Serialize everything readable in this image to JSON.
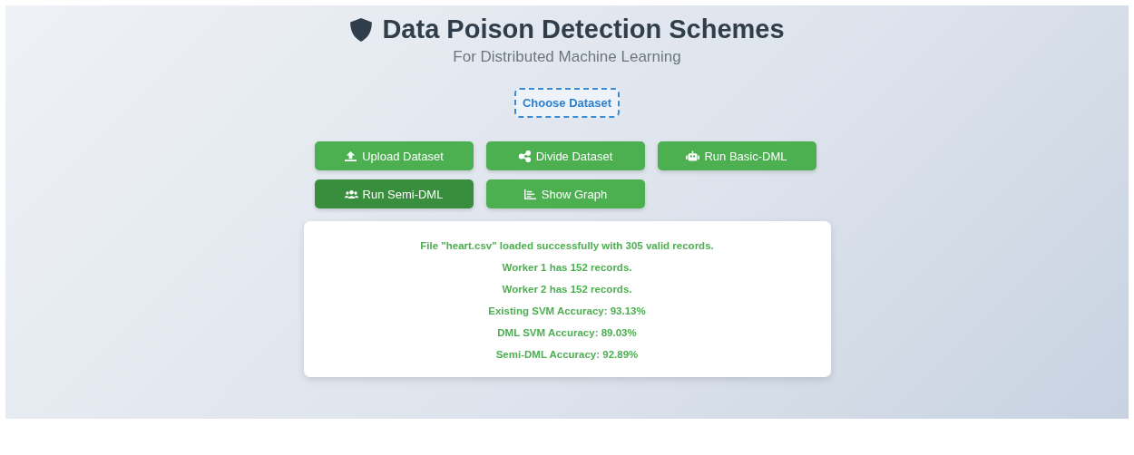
{
  "header": {
    "title": "Data Poison Detection Schemes",
    "subtitle": "For Distributed Machine Learning"
  },
  "file_picker": {
    "label": "Choose Dataset"
  },
  "buttons": [
    {
      "label": "Upload Dataset",
      "selected": false
    },
    {
      "label": "Divide Dataset",
      "selected": false
    },
    {
      "label": "Run Basic-DML",
      "selected": false
    },
    {
      "label": "Run Semi-DML",
      "selected": true
    },
    {
      "label": "Show Graph",
      "selected": false
    }
  ],
  "results": [
    "File \"heart.csv\" loaded successfully with 305 valid records.",
    "Worker 1 has 152 records.",
    "Worker 2 has 152 records.",
    "Existing SVM Accuracy: 93.13%",
    "DML SVM Accuracy: 89.03%",
    "Semi-DML Accuracy: 92.89%"
  ]
}
